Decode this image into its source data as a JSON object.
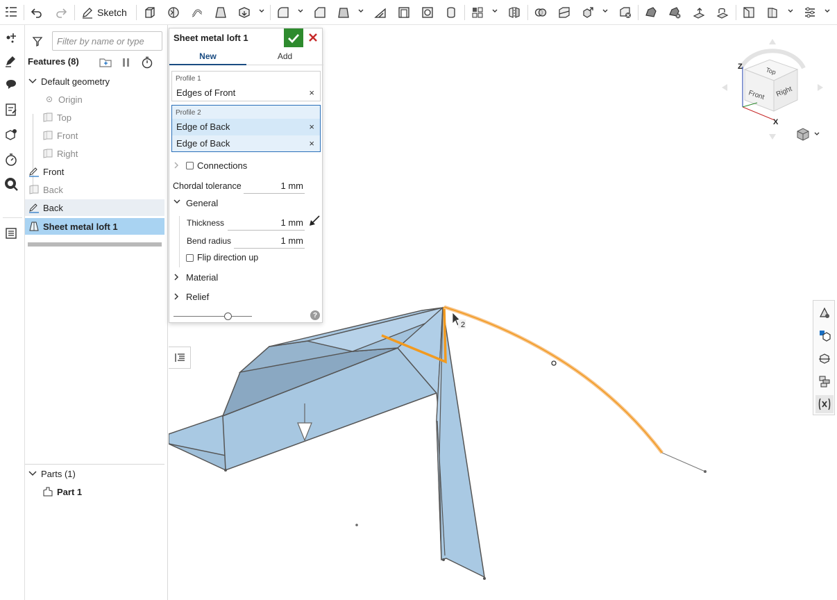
{
  "toolbar": {
    "sketch_label": "Sketch"
  },
  "feature_panel": {
    "filter_placeholder": "Filter by name or type",
    "features_header": "Features (8)",
    "tree": {
      "default_geometry": "Default geometry",
      "origin": "Origin",
      "top": "Top",
      "front_plane": "Front",
      "right": "Right",
      "front_sketch": "Front",
      "back_hidden": "Back",
      "back_sketch": "Back",
      "sheet_metal_loft": "Sheet metal loft 1"
    },
    "parts_header": "Parts (1)",
    "part_1": "Part 1"
  },
  "dialog": {
    "title": "Sheet metal loft 1",
    "tab_new": "New",
    "tab_add": "Add",
    "profile1_label": "Profile 1",
    "profile1_item": "Edges of Front",
    "profile2_label": "Profile 2",
    "profile2_item1": "Edge of Back",
    "profile2_item2": "Edge of Back",
    "remove_glyph": "×",
    "connections_label": "Connections",
    "chordal_label": "Chordal tolerance",
    "chordal_value": "1 mm",
    "general_label": "General",
    "thickness_label": "Thickness",
    "thickness_value": "1 mm",
    "bend_radius_label": "Bend radius",
    "bend_radius_value": "1 mm",
    "flip_label": "Flip direction up",
    "material_label": "Material",
    "relief_label": "Relief",
    "help_glyph": "?"
  },
  "view_cube": {
    "top": "Top",
    "front": "Front",
    "right": "Right",
    "axis_x": "X",
    "axis_z": "Z"
  },
  "viewport": {
    "cursor_badge": "2"
  },
  "colors": {
    "selection_orange": "#f29a1f",
    "accent_blue": "#1a4c82",
    "confirm_green": "#2e8b2e",
    "cancel_red": "#c62828",
    "part_fill": "#a9c9e3"
  }
}
